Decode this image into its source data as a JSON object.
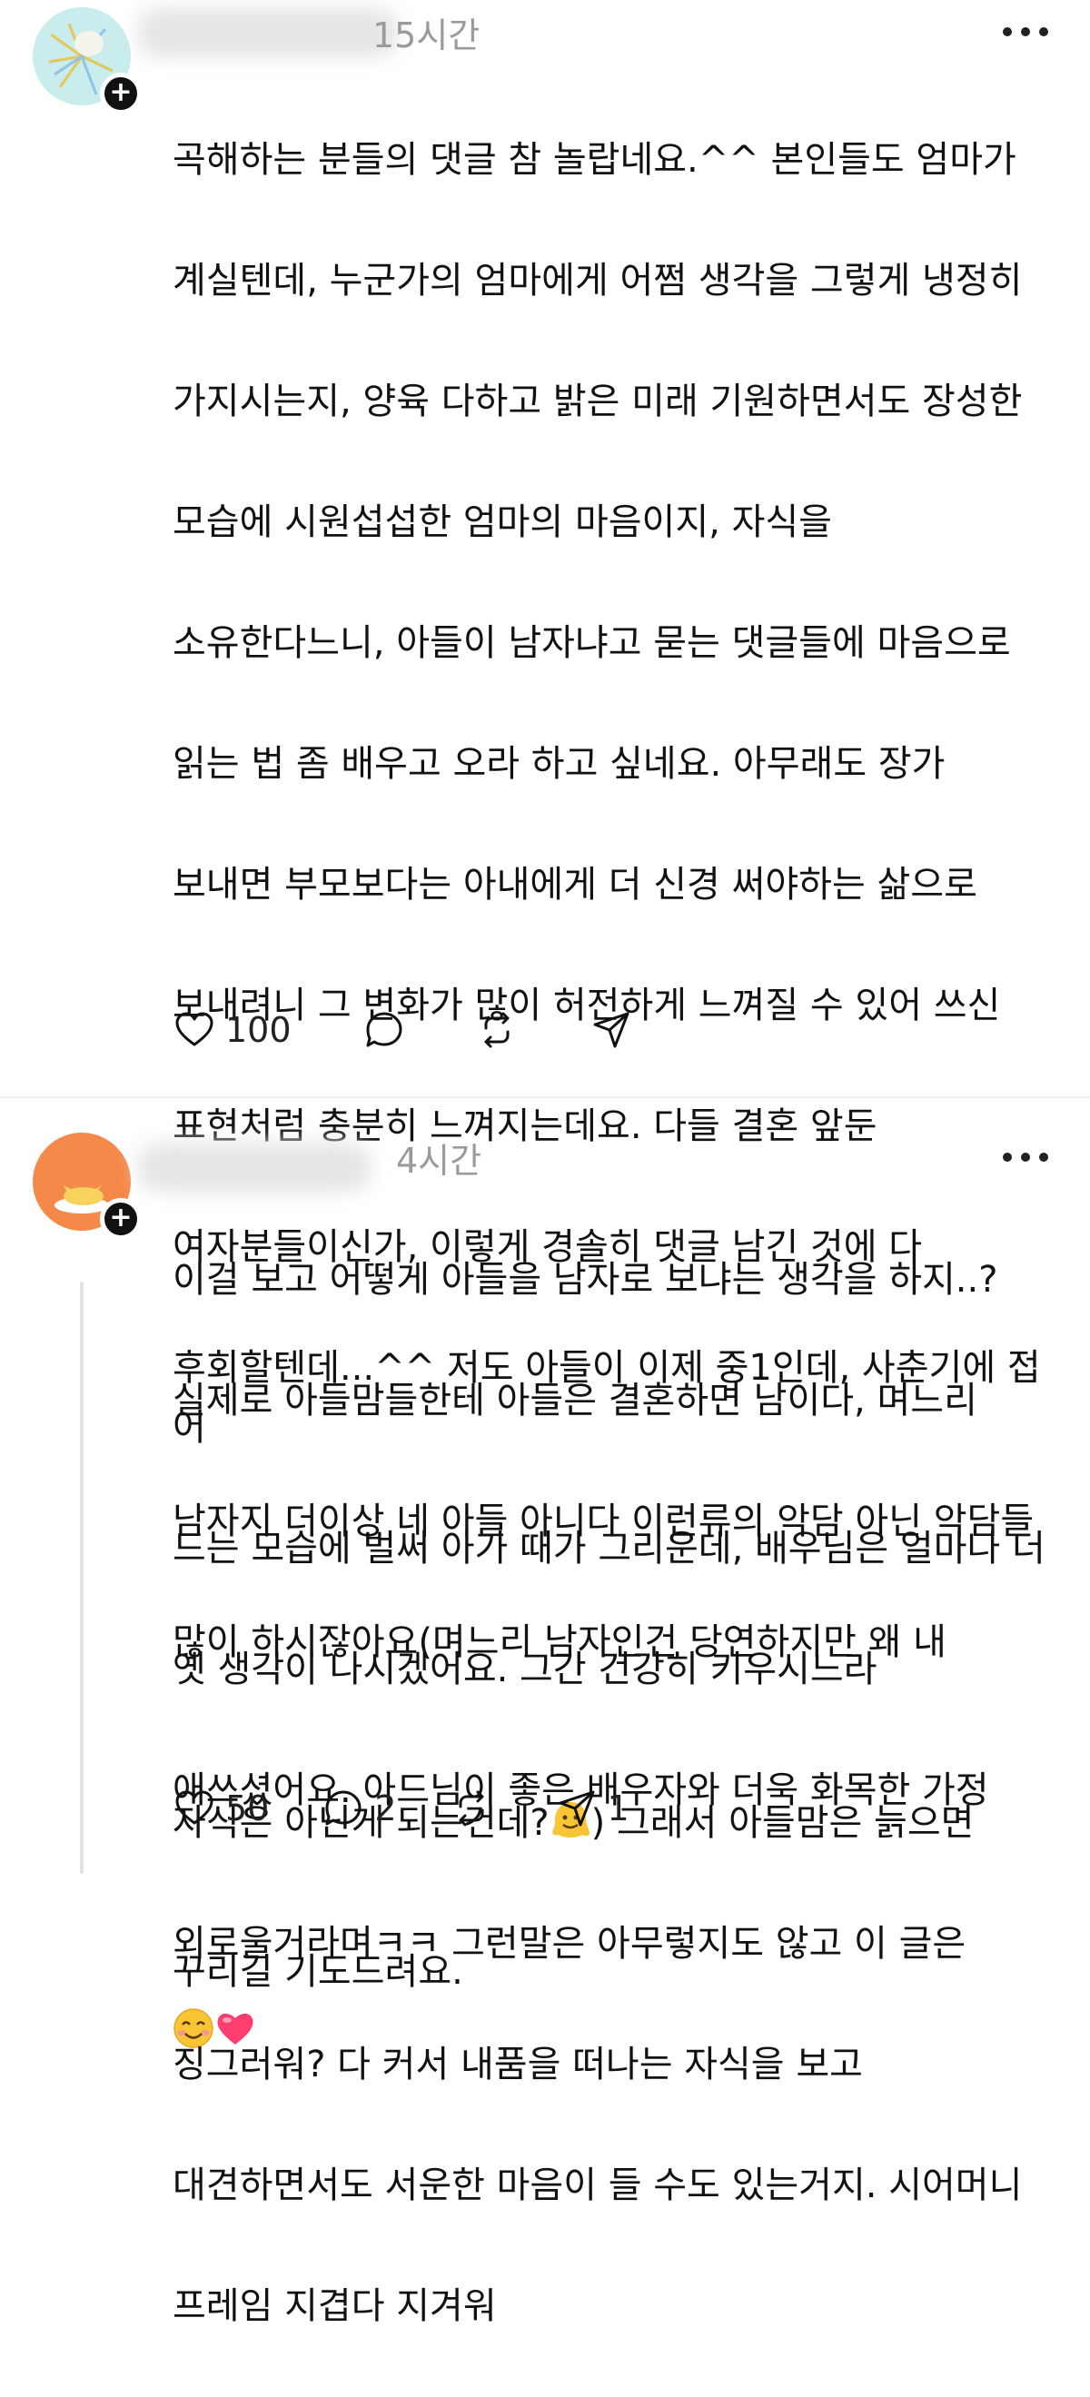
{
  "posts": [
    {
      "time": "15시간",
      "lines": [
        "곡해하는 분들의 댓글 참 놀랍네요.^^ 본인들도 엄마가",
        "계실텐데, 누군가의 엄마에게 어쩜 생각을 그렇게 냉정히",
        "가지시는지, 양육 다하고 밝은 미래 기원하면서도 장성한",
        "모습에 시원섭섭한 엄마의 마음이지, 자식을",
        "소유한다느니, 아들이 남자냐고 묻는 댓글들에 마음으로",
        "읽는 법 좀 배우고 오라 하고 싶네요. 아무래도 장가",
        "보내면 부모보다는 아내에게 더 신경 써야하는 삶으로",
        "보내려니 그 변화가 많이 허전하게 느껴질 수 있어 쓰신",
        "표현처럼 충분히 느껴지는데요. 다들 결혼 앞둔",
        "여자분들이신가, 이렇게 경솔히 댓글 남긴 것에 다",
        "후회할텐데...^^ 저도 아들이 이제 중1인데, 사춘기에 접어",
        "드는 모습에 벌써 아가 때가 그리운데, 배우님은 얼마나 더",
        "옛 생각이 나시겠어요. 그간 건강히 키우시느라",
        "애쓰셨어요. 아드님이 좋은 배우자와 더욱 화목한 가정",
        "꾸리길 기도드려요."
      ],
      "likes": "100",
      "replies": "",
      "reposts": "",
      "shares": ""
    },
    {
      "time": "4시간",
      "lines": [
        "이걸 보고 어떻게 아들을 남자로 보냐는 생각을 하지..?",
        "실제로 아들맘들한테 아들은 결혼하면 남이다, 며느리",
        "남자지 더이상 네 아들 아니다 이런류의 악담 아닌 악담들",
        "많이 하시잖아요(며느리 남자인건 당연하지만 왜 내",
        "자식은 아닌게 되는건데?",
        "외로울거라며ㅋㅋ 그런말은 아무렇지도 않고 이 글은",
        "징그러워?  다 커서  내품을 떠나는 자식을 보고",
        "대견하면서도 서운한 마음이 들 수도 있는거지. 시어머니",
        "프레임 지겹다 지겨워"
      ],
      "line5_tail": ") 그래서 아들맘은 늙으면",
      "likes": "50",
      "replies": "2",
      "reposts": "",
      "shares": "1"
    }
  ],
  "icons": [
    "like-icon",
    "reply-icon",
    "repost-icon",
    "share-icon",
    "more-icon",
    "follow-plus-icon",
    "smile-emoji-icon",
    "heart-emoji-icon",
    "melting-face-emoji-icon"
  ]
}
